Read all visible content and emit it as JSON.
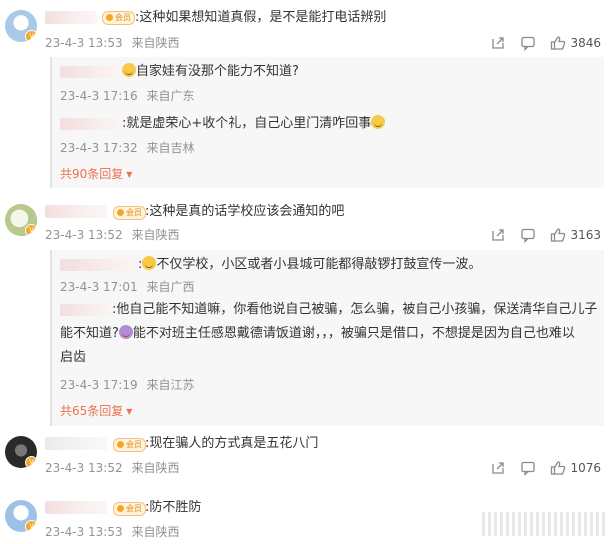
{
  "badge_label": "会员",
  "icons": {
    "share": "share-icon",
    "comment": "comment-icon",
    "like": "thumbs-up-icon"
  },
  "colors": {
    "meta": "#939393",
    "link_orange": "#eb7350",
    "badge": "#f5a623"
  },
  "comments": [
    {
      "text": ":这种如果想知道真假，是不是能打电话辨别",
      "date": "23-4-3 13:53",
      "location": "来自陕西",
      "likes": "3846",
      "replies": [
        {
          "text": "自家娃有没那个能力不知道?",
          "date": "23-4-3 17:16",
          "location": "来自广东"
        },
        {
          "text": ":就是虚荣心+收个礼，自己心里门清咋回事",
          "date": "23-4-3 17:32",
          "location": "来自吉林"
        }
      ],
      "more_replies": "共90条回复"
    },
    {
      "text": ":这种是真的话学校应该会通知的吧",
      "date": "23-4-3 13:52",
      "location": "来自陕西",
      "likes": "3163",
      "replies": [
        {
          "text": "不仅学校，小区或者小县城可能都得敲锣打鼓宣传一波。",
          "date": "23-4-3 17:01",
          "location": "来自广西"
        },
        {
          "text_line1": ":他自己能不知道嘛，你看他说自己被骗，怎么骗，被自己小孩骗，保送清华自己儿子",
          "text_line2_a": "能不知道?",
          "text_line2_b": "能不对班主任感恩戴德请饭道谢，，，被骗只是借口，不想提是因为自己也难以",
          "text_line3": "启齿",
          "date": "23-4-3 17:19",
          "location": "来自江苏"
        }
      ],
      "more_replies": "共65条回复"
    },
    {
      "text": ":现在骗人的方式真是五花八门",
      "date": "23-4-3 13:52",
      "location": "来自陕西",
      "likes": "1076"
    },
    {
      "text": ":防不胜防",
      "date": "23-4-3 13:53",
      "location": "来自陕西"
    }
  ]
}
